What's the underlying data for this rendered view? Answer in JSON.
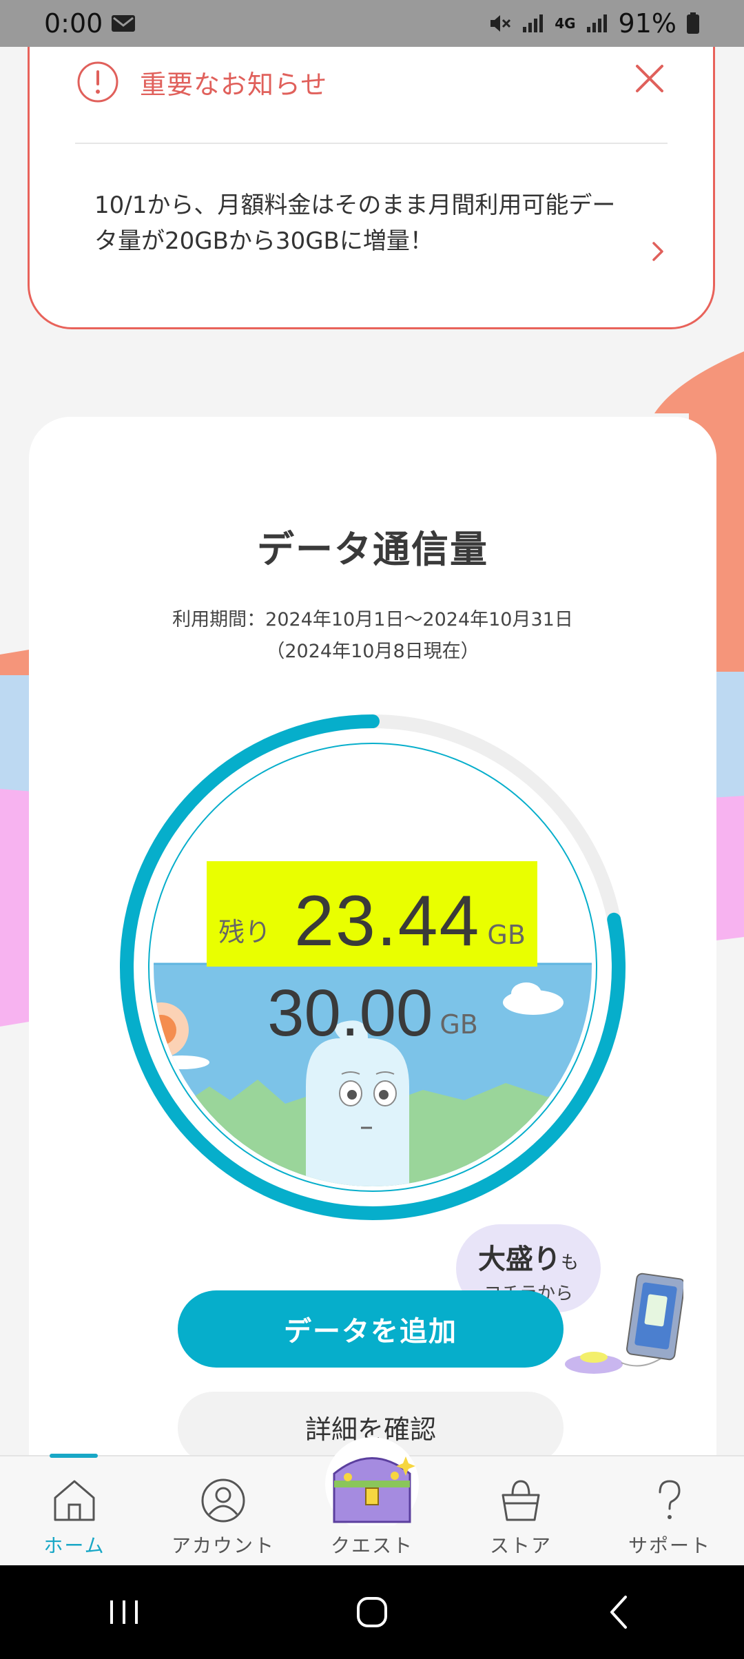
{
  "status_bar": {
    "time": "0:00",
    "network": "4G",
    "battery": "91%"
  },
  "notice": {
    "title": "重要なお知らせ",
    "message": "10/1から、月額料金はそのまま月間利用可能データ量が20GBから30GBに増量！"
  },
  "usage": {
    "heading": "データ通信量",
    "period": "利用期間：2024年10月1日〜2024年10月31日",
    "as_of": "（2024年10月8日現在）",
    "remaining_label": "残り",
    "remaining_value": "23.44",
    "remaining_unit": "GB",
    "total_value": "30.00",
    "total_unit": "GB",
    "remaining_fraction": 0.781
  },
  "promo": {
    "big": "大盛り",
    "big_suffix": "も",
    "small": "コチラから"
  },
  "buttons": {
    "add_data": "データを追加",
    "details": "詳細を確認"
  },
  "bottom_nav": {
    "items": [
      {
        "label": "ホーム",
        "icon": "home-icon",
        "active": true
      },
      {
        "label": "アカウント",
        "icon": "account-icon",
        "active": false
      },
      {
        "label": "クエスト",
        "icon": "treasure-chest-icon",
        "active": false
      },
      {
        "label": "ストア",
        "icon": "shopping-bag-icon",
        "active": false
      },
      {
        "label": "サポート",
        "icon": "question-icon",
        "active": false
      }
    ]
  },
  "colors": {
    "accent": "#06aecb",
    "alert": "#e8625a",
    "highlight": "#e9ff00"
  }
}
